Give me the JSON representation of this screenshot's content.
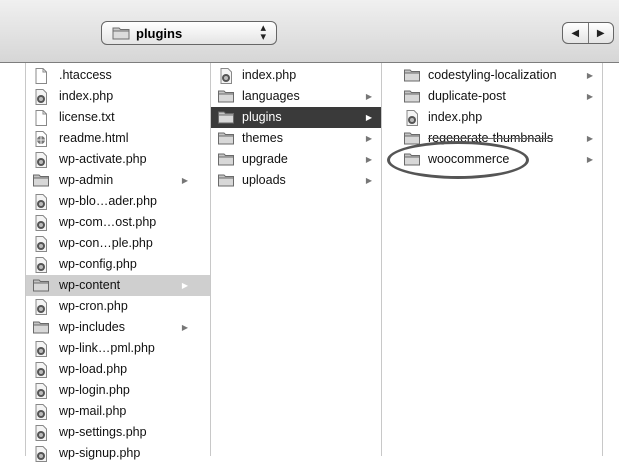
{
  "toolbar": {
    "path_label": "plugins",
    "back_glyph": "◀",
    "forward_glyph": "▶",
    "popup_up_glyph": "▴",
    "popup_down_glyph": "▾"
  },
  "icons": {
    "folder": "folder-icon",
    "php": "php-file-icon",
    "text": "text-file-icon",
    "html": "html-file-icon"
  },
  "colors": {
    "selected_active": "#3a3a3a",
    "selected_inactive": "#cfcfcf",
    "oval": "#555555"
  },
  "column1": [
    {
      "label": ".htaccess",
      "icon": "text"
    },
    {
      "label": "index.php",
      "icon": "php"
    },
    {
      "label": "license.txt",
      "icon": "text"
    },
    {
      "label": "readme.html",
      "icon": "html"
    },
    {
      "label": "wp-activate.php",
      "icon": "php"
    },
    {
      "label": "wp-admin",
      "icon": "folder"
    },
    {
      "label": "wp-blo…ader.php",
      "icon": "php"
    },
    {
      "label": "wp-com…ost.php",
      "icon": "php"
    },
    {
      "label": "wp-con…ple.php",
      "icon": "php"
    },
    {
      "label": "wp-config.php",
      "icon": "php"
    },
    {
      "label": "wp-content",
      "icon": "folder"
    },
    {
      "label": "wp-cron.php",
      "icon": "php"
    },
    {
      "label": "wp-includes",
      "icon": "folder"
    },
    {
      "label": "wp-link…pml.php",
      "icon": "php"
    },
    {
      "label": "wp-load.php",
      "icon": "php"
    },
    {
      "label": "wp-login.php",
      "icon": "php"
    },
    {
      "label": "wp-mail.php",
      "icon": "php"
    },
    {
      "label": "wp-settings.php",
      "icon": "php"
    },
    {
      "label": "wp-signup.php",
      "icon": "php"
    }
  ],
  "column2": [
    {
      "label": "index.php",
      "icon": "php"
    },
    {
      "label": "languages",
      "icon": "folder"
    },
    {
      "label": "plugins",
      "icon": "folder"
    },
    {
      "label": "themes",
      "icon": "folder"
    },
    {
      "label": "upgrade",
      "icon": "folder"
    },
    {
      "label": "uploads",
      "icon": "folder"
    }
  ],
  "column3": [
    {
      "label": "codestyling-localization",
      "icon": "folder"
    },
    {
      "label": "duplicate-post",
      "icon": "folder"
    },
    {
      "label": "index.php",
      "icon": "php"
    },
    {
      "label": "regenerate-thumbnails",
      "icon": "folder"
    },
    {
      "label": "woocommerce",
      "icon": "folder"
    }
  ]
}
